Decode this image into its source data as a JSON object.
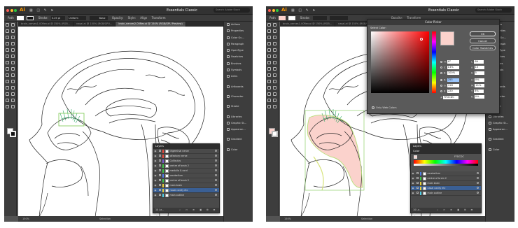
{
  "ai_logo": "Ai",
  "colors": {
    "accent": "#ff9a00",
    "selection": "#3a5f94",
    "fill_swatch": "#fbd2cc"
  },
  "left": {
    "workspace": "Essentials Classic",
    "search_placeholder": "Search Adobe Stock",
    "control": {
      "path": "Path",
      "stroke": "Stroke:",
      "stroke_weight": "0.25 pt",
      "uniform": "Uniform",
      "brush": "Basic",
      "opacity": "Opacity:",
      "opacity_value": "Style:",
      "align": "Align",
      "transform": "Transform"
    },
    "tabs": [
      "brain_nerves1-00Rev.ai @ 150% (RGB...",
      "nasal.ai @ 150% (RGB/GPU...",
      "brain_nerves2-00Rev.ai @ 150% (RGB/GPU Preview)"
    ],
    "dock": [
      "Actions",
      "Properties",
      "Color Gu...",
      "Paragraph",
      "OpenType",
      "Swatches",
      "Brushes",
      "Symbols",
      "Links",
      "Artboards",
      "Character",
      "Stroke",
      "Libraries",
      "Graphic St...",
      "Appearan...",
      "Gradient",
      "Color"
    ],
    "layers_title": "Layers",
    "layers": [
      {
        "name": "trigeminal nerve",
        "color": "#e8483c"
      },
      {
        "name": "olfactory nerve",
        "color": "#e8483c"
      },
      {
        "name": "Colliculus",
        "color": "#7a5bd1"
      },
      {
        "name": "centre of brain 2",
        "color": "#3cc44a"
      },
      {
        "name": "medulla & cord",
        "color": "#3cc44a"
      },
      {
        "name": "cerebellum",
        "color": "#4f7ee8"
      },
      {
        "name": "centre of brain 2",
        "color": "#3cc44a"
      },
      {
        "name": "main brain",
        "color": "#e8d03c"
      },
      {
        "name": "nasal cavity etc",
        "color": "#e8d03c"
      },
      {
        "name": "main outline",
        "color": "#4fd0e8"
      }
    ],
    "layers_count": "10 La...",
    "zoom": "150%",
    "status": "Selection"
  },
  "right": {
    "workspace": "Essentials Classic",
    "search_placeholder": "Search Adobe Stock",
    "control": {
      "path": "Path",
      "stroke": "Stroke:",
      "opacity": "Opacity:",
      "transform": "Transform"
    },
    "tabs": [
      "brain_nerves1-00Rev.ai @ 150% (RGB...",
      "nasal.ai @ 150% (RGB/GPU...",
      "brain_nerves2-00Rev.ai @ 150% (RGB/GPU Preview)"
    ],
    "dock": [
      "Actions",
      "Properties",
      "Color Gu...",
      "Paragraph",
      "OpenType",
      "Swatches",
      "Brushes",
      "Symbols",
      "Links",
      "Artboards",
      "Character",
      "Stroke",
      "Libraries",
      "Graphic St...",
      "Appearan...",
      "Gradient",
      "Color"
    ],
    "picker": {
      "title": "Color Picker",
      "select_color": "Select Color:",
      "ok": "OK",
      "cancel": "Cancel",
      "swatches": "Color Swatches",
      "h_label": "H:",
      "h": "8°",
      "s_label": "S:",
      "s": "13%",
      "b_label": "B:",
      "b": "100%",
      "r_label": "R:",
      "r": "255",
      "g_label": "G:",
      "g": "220",
      "bl_label": "B:",
      "bl": "220",
      "l_label": "L:",
      "l": "89",
      "a_label": "a:",
      "a": "15",
      "bb_label": "b:",
      "bb": "5",
      "c_label": "C:",
      "c": "0%",
      "m_label": "M:",
      "m": "21%",
      "y_label": "Y:",
      "y": "8%",
      "k_label": "K:",
      "k": "0%",
      "hex": "FFDCDC",
      "web": "Only Web Colors"
    },
    "color_title": "Color",
    "color_hex": "FFDCDC",
    "layers_title": "Layers",
    "layers": [
      {
        "name": "cerebellum",
        "color": "#4f7ee8"
      },
      {
        "name": "centre of brain 2",
        "color": "#3cc44a"
      },
      {
        "name": "main brain",
        "color": "#e8d03c"
      },
      {
        "name": "nasal cavity etc",
        "color": "#e8d03c"
      },
      {
        "name": "main outline",
        "color": "#4fd0e8"
      }
    ],
    "layers_count": "10 La...",
    "zoom": "150%",
    "status": "Selection"
  }
}
